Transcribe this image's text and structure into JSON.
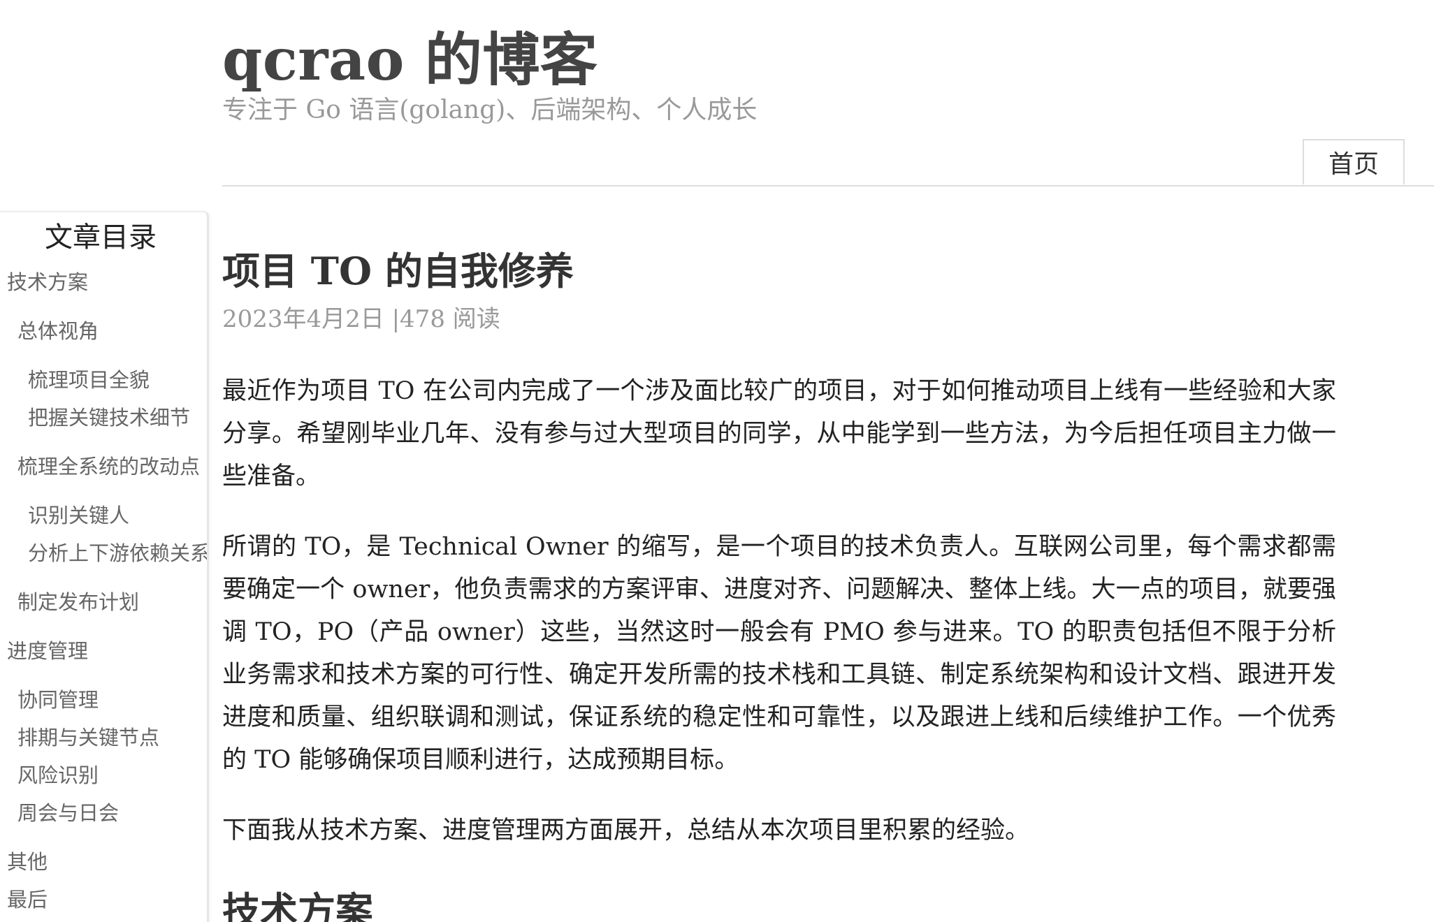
{
  "header": {
    "site_title": "qcrao 的博客",
    "site_subtitle": "专注于 Go 语言(golang)、后端架构、个人成长",
    "nav": {
      "home_label": "首页"
    }
  },
  "toc": {
    "title": "文章目录",
    "items": [
      {
        "label": "技术方案",
        "level": 1
      },
      {
        "label": "总体视角",
        "level": 2
      },
      {
        "label": "梳理项目全貌",
        "level": 3
      },
      {
        "label": "把握关键技术细节",
        "level": 3
      },
      {
        "label": "梳理全系统的改动点",
        "level": 2
      },
      {
        "label": "识别关键人",
        "level": 3
      },
      {
        "label": "分析上下游依赖关系",
        "level": 3
      },
      {
        "label": "制定发布计划",
        "level": 2
      },
      {
        "label": "进度管理",
        "level": 1
      },
      {
        "label": "协同管理",
        "level": 2
      },
      {
        "label": "排期与关键节点",
        "level": 2
      },
      {
        "label": "风险识别",
        "level": 2
      },
      {
        "label": "周会与日会",
        "level": 2
      },
      {
        "label": "其他",
        "level": 1
      },
      {
        "label": "最后",
        "level": 1
      }
    ]
  },
  "article": {
    "title": "项目 TO 的自我修养",
    "meta": "2023年4月2日 |478 阅读",
    "paragraphs": [
      "最近作为项目 TO 在公司内完成了一个涉及面比较广的项目，对于如何推动项目上线有一些经验和大家分享。希望刚毕业几年、没有参与过大型项目的同学，从中能学到一些方法，为今后担任项目主力做一些准备。",
      "所谓的 TO，是 Technical Owner 的缩写，是一个项目的技术负责人。互联网公司里，每个需求都需要确定一个 owner，他负责需求的方案评审、进度对齐、问题解决、整体上线。大一点的项目，就要强调 TO，PO（产品 owner）这些，当然这时一般会有 PMO 参与进来。TO 的职责包括但不限于分析业务需求和技术方案的可行性、确定开发所需的技术栈和工具链、制定系统架构和设计文档、跟进开发进度和质量、组织联调和测试，保证系统的稳定性和可靠性，以及跟进上线和后续维护工作。一个优秀的 TO 能够确保项目顺利进行，达成预期目标。",
      "下面我从技术方案、进度管理两方面展开，总结从本次项目里积累的经验。"
    ],
    "section_heading": "技术方案"
  }
}
